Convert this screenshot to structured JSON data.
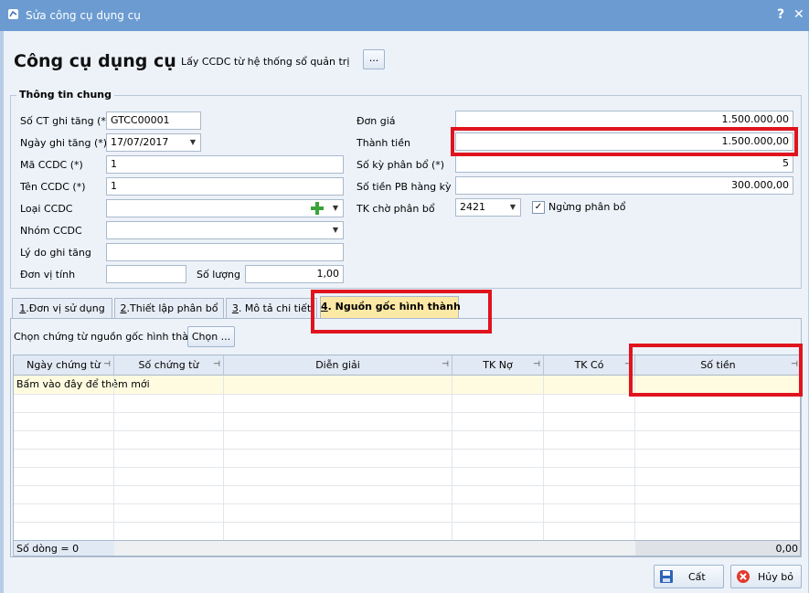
{
  "window": {
    "title": "Sửa công cụ dụng cụ",
    "help_glyph": "?",
    "close_glyph": "✕"
  },
  "header": {
    "title": "Công cụ dụng cụ",
    "import_label": "Lấy CCDC từ hệ thống sổ quản trị",
    "import_button": "..."
  },
  "general": {
    "group_title": "Thông tin chung",
    "so_ct_label": "Số CT ghi tăng (*)",
    "so_ct_value": "GTCC00001",
    "ngay_label": "Ngày ghi tăng (*)",
    "ngay_value": "17/07/2017",
    "ma_label": "Mã CCDC (*)",
    "ma_value": "1",
    "ten_label": "Tên CCDC (*)",
    "ten_value": "1",
    "loai_label": "Loại CCDC",
    "loai_value": "",
    "nhom_label": "Nhóm CCDC",
    "nhom_value": "",
    "lydo_label": "Lý do ghi tăng",
    "lydo_value": "",
    "dvt_label": "Đơn vị tính",
    "dvt_value": "",
    "soluong_label": "Số lượng",
    "soluong_value": "1,00",
    "dongia_label": "Đơn giá",
    "dongia_value": "1.500.000,00",
    "thanhtien_label": "Thành tiền",
    "thanhtien_value": "1.500.000,00",
    "sokypb_label": "Số kỳ phân bổ (*)",
    "sokypb_value": "5",
    "sotienpb_label": "Số tiền PB hàng kỳ",
    "sotienpb_value": "300.000,00",
    "tkcho_label": "TK chờ phân bổ",
    "tkcho_value": "2421",
    "ngung_label": "Ngừng phân bổ",
    "ngung_checked": true
  },
  "tabs": [
    {
      "key": "1",
      "label": ".Đơn vị sử dụng"
    },
    {
      "key": "2",
      "label": ".Thiết lập phân bổ"
    },
    {
      "key": "3",
      "label": ". Mô tả chi tiết"
    },
    {
      "key": "4",
      "label": ". Nguồn gốc hình thành"
    }
  ],
  "active_tab": 3,
  "origin": {
    "choose_label": "Chọn chứng từ nguồn gốc hình thành",
    "choose_button": "Chọn ...",
    "columns": [
      "Ngày chứng từ",
      "Số chứng từ",
      "Diễn giải",
      "TK Nợ",
      "TK Có",
      "Số tiền"
    ],
    "new_row_hint": "Bấm vào đây để thêm mới",
    "footer_count": "Số dòng = 0",
    "footer_total": "0,00"
  },
  "buttons": {
    "save": "Cất",
    "cancel": "Hủy bỏ"
  },
  "colors": {
    "title_bar": "#6b9bd1",
    "highlight": "#e0141e",
    "active_tab": "#fde9a6",
    "new_row": "#fffbe0"
  }
}
